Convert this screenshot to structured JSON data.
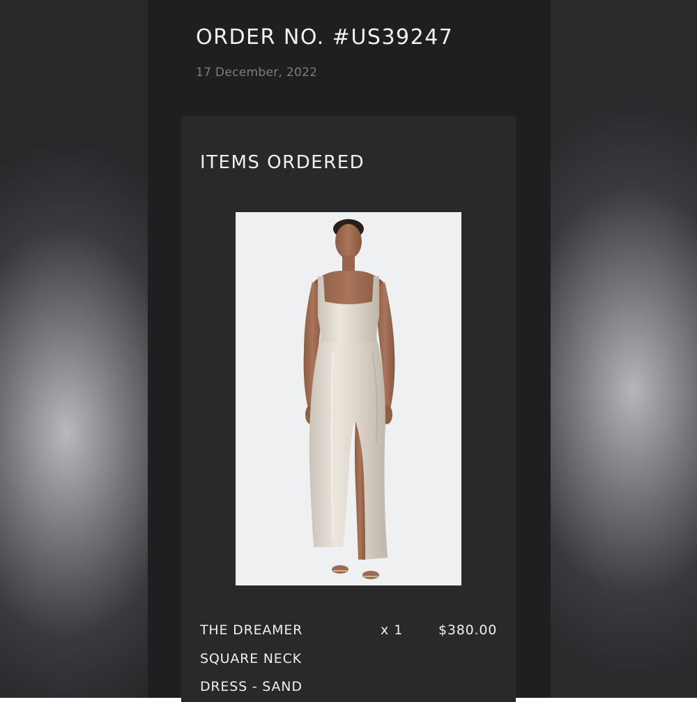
{
  "order": {
    "title": "ORDER NO. #US39247",
    "date": "17 December, 2022"
  },
  "items_section": {
    "title": "ITEMS ORDERED",
    "items": [
      {
        "name_lines": [
          "THE DREAMER",
          "SQUARE NECK",
          "DRESS - SAND"
        ],
        "quantity": "x 1",
        "price": "$380.00",
        "image": "product-photo-sand-satin-maxi-dress"
      }
    ]
  },
  "colors": {
    "panel_background": "#1f1f21",
    "card_background": "#29292b",
    "primary_text": "#f2f2f2",
    "secondary_text": "#7d7d80",
    "image_background": "#eff0f2"
  }
}
